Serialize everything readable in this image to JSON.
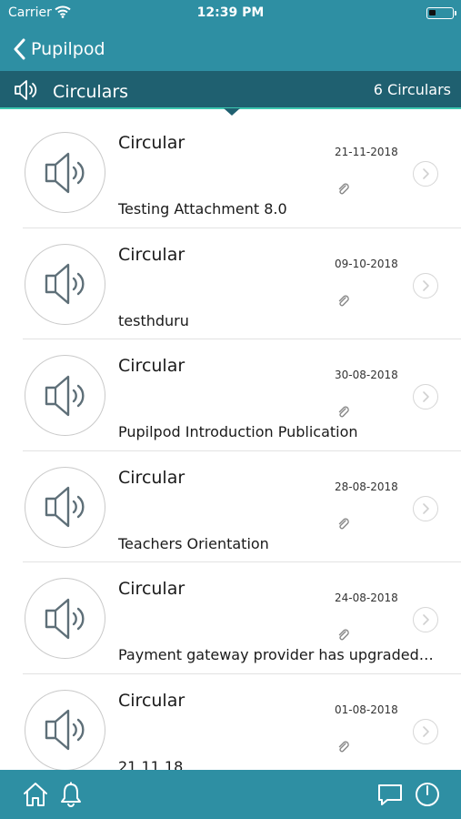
{
  "status_bar": {
    "carrier": "Carrier",
    "time": "12:39 PM",
    "battery_level": 0.3,
    "wifi_icon": "wifi-icon",
    "battery_icon": "battery-icon"
  },
  "nav": {
    "back_label": "Pupilpod",
    "back_icon": "chevron-left-icon"
  },
  "section": {
    "title": "Circulars",
    "count": "6 Circulars",
    "icon": "speaker-icon"
  },
  "circulars": [
    {
      "title": "Circular",
      "date": "21-11-2018",
      "subtitle": "Testing Attachment 8.0"
    },
    {
      "title": "Circular",
      "date": "09-10-2018",
      "subtitle": "testhduru"
    },
    {
      "title": "Circular",
      "date": "30-08-2018",
      "subtitle": "Pupilpod Introduction Publication"
    },
    {
      "title": "Circular",
      "date": "28-08-2018",
      "subtitle": "Teachers Orientation"
    },
    {
      "title": "Circular",
      "date": "24-08-2018",
      "subtitle": "Payment gateway provider has upgraded t..."
    },
    {
      "title": "Circular",
      "date": "01-08-2018",
      "subtitle": "21.11.18"
    }
  ],
  "tab_bar": {
    "icons": [
      "home-icon",
      "bell-icon",
      "chat-icon",
      "power-icon"
    ]
  },
  "colors": {
    "primary": "#2e8fa3",
    "header_dark": "#1f6070",
    "accent_line": "#3cc7b0"
  }
}
